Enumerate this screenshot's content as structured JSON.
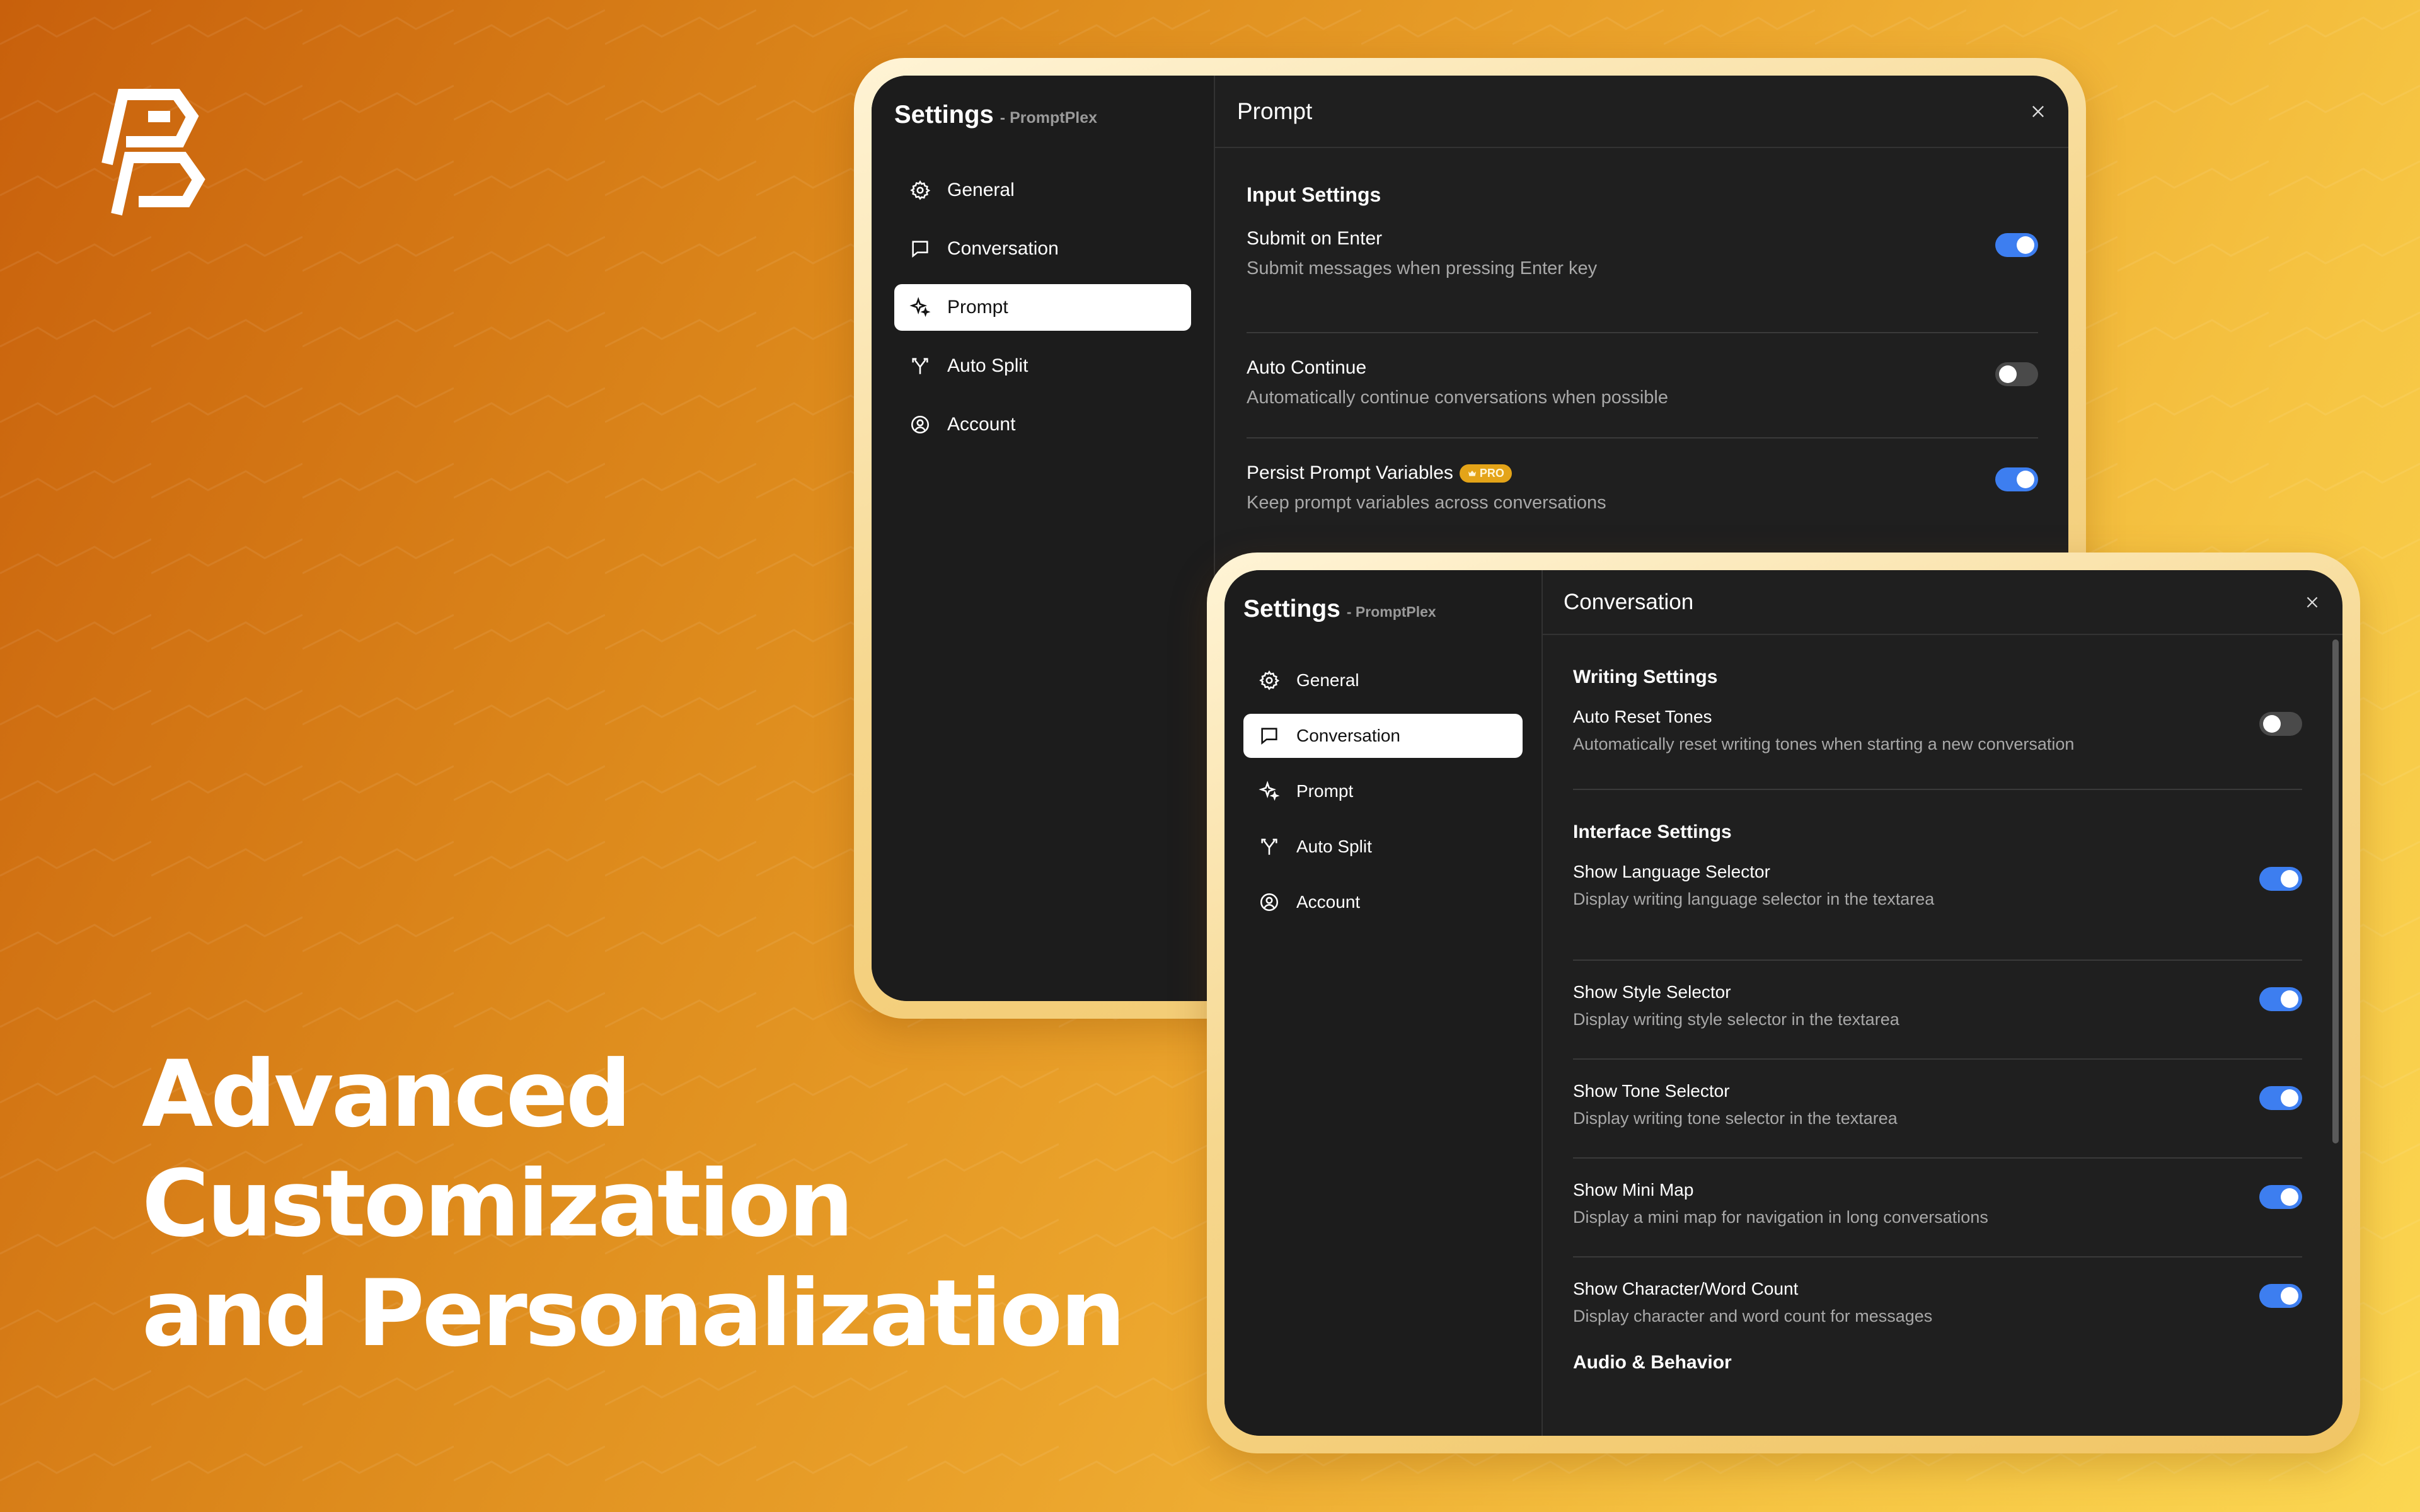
{
  "brand": {
    "logo_icon": "promptplex-logo-icon"
  },
  "headline": {
    "line1": "Advanced",
    "line2": "Customization",
    "line3": "and Personalization"
  },
  "windows": {
    "back": {
      "app_title": "Settings",
      "app_subtitle": "- PromptPlex",
      "header_title": "Prompt",
      "nav": [
        {
          "label": "General",
          "icon": "gear-icon"
        },
        {
          "label": "Conversation",
          "icon": "chat-bubble-icon"
        },
        {
          "label": "Prompt",
          "icon": "sparkle-icon",
          "active": true
        },
        {
          "label": "Auto Split",
          "icon": "split-arrows-icon"
        },
        {
          "label": "Account",
          "icon": "user-circle-icon"
        }
      ],
      "section_title": "Input Settings",
      "settings": [
        {
          "label": "Submit on Enter",
          "desc": "Submit messages when pressing Enter key",
          "on": true
        },
        {
          "label": "Auto Continue",
          "desc": "Automatically continue conversations when possible",
          "on": false
        },
        {
          "label": "Persist Prompt Variables",
          "badge": "PRO",
          "desc": "Keep prompt variables across conversations",
          "on": true
        }
      ]
    },
    "front": {
      "app_title": "Settings",
      "app_subtitle": "- PromptPlex",
      "header_title": "Conversation",
      "nav": [
        {
          "label": "General",
          "icon": "gear-icon"
        },
        {
          "label": "Conversation",
          "icon": "chat-bubble-icon",
          "active": true
        },
        {
          "label": "Prompt",
          "icon": "sparkle-icon"
        },
        {
          "label": "Auto Split",
          "icon": "split-arrows-icon"
        },
        {
          "label": "Account",
          "icon": "user-circle-icon"
        }
      ],
      "writing_title": "Writing Settings",
      "writing": [
        {
          "label": "Auto Reset Tones",
          "desc": "Automatically reset writing tones when starting a new conversation",
          "on": false
        }
      ],
      "interface_title": "Interface Settings",
      "interface": [
        {
          "label": "Show Language Selector",
          "desc": "Display writing language selector in the textarea",
          "on": true
        },
        {
          "label": "Show Style Selector",
          "desc": "Display writing style selector in the textarea",
          "on": true
        },
        {
          "label": "Show Tone Selector",
          "desc": "Display writing tone selector in the textarea",
          "on": true
        },
        {
          "label": "Show Mini Map",
          "desc": "Display a mini map for navigation in long conversations",
          "on": true
        },
        {
          "label": "Show Character/Word Count",
          "desc": "Display character and word count for messages",
          "on": true
        }
      ],
      "audio_title": "Audio & Behavior"
    }
  },
  "colors": {
    "accent_toggle": "#3d7ef0",
    "window_bg": "#1f1f1f",
    "pro_badge": "#e4a418"
  }
}
